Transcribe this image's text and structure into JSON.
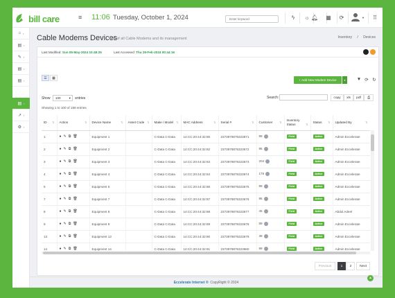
{
  "header": {
    "logo_text": "bill care",
    "time": "11:06",
    "date": "Tuesday, October 1, 2024",
    "search_placeholder": "Enter keyword",
    "icons": [
      "bolt-icon",
      "sun-icon",
      "bell-icon",
      "grid-icon",
      "sync-icon",
      "user-avatar-icon",
      "apps-icon"
    ]
  },
  "sidebar": {
    "items": [
      {
        "icon": "home-icon"
      },
      {
        "icon": "list-icon"
      },
      {
        "icon": "wrench-icon"
      },
      {
        "icon": "list-icon"
      },
      {
        "icon": "list-icon"
      },
      {
        "icon": "list-icon",
        "active": true
      },
      {
        "icon": "chart-icon"
      },
      {
        "icon": "settings-icon"
      }
    ]
  },
  "page": {
    "title": "Cable Modems Devices",
    "subtitle": "List of all Cable Modems and its management",
    "breadcrumb": [
      "Inventory",
      "Devices"
    ]
  },
  "meta": {
    "last_modified_label": "Last Modified:",
    "last_modified_value": "Sun 05-May-2024 10:48:25",
    "last_accessed_label": "Last Accessed:",
    "last_accessed_value": "Thu 29-Feb-2024 00:44:16"
  },
  "toolbar": {
    "add_button": "+ Add New Modem Device",
    "show_label": "Show",
    "show_value": "100",
    "entries_label": "entries",
    "search_label": "Search:",
    "export_buttons": [
      "copy",
      "xls",
      "pdf"
    ],
    "showing_text": "Showing 1 to 100 of 159 entries"
  },
  "table": {
    "columns": [
      "ID",
      "Action",
      "Device Name",
      "Asset Code",
      "Make / Model",
      "MAC Address",
      "Serial #",
      "Customer",
      "Inventory Status",
      "Status",
      "Updated By"
    ],
    "rows": [
      {
        "id": "1",
        "name": "Equipment 1",
        "asset": "",
        "model": "C-Data C-Data",
        "mac": "14:CC:20:44:32:85",
        "serial": "2373978876323671",
        "customer": "89",
        "inv": "Field",
        "status": "Active",
        "updated": "Admin Eccelerate"
      },
      {
        "id": "2",
        "name": "Equipment 2",
        "asset": "",
        "model": "C-Data C-Data",
        "mac": "14:CC:20:44:32:82",
        "serial": "2373978876323672",
        "customer": "85",
        "inv": "Field",
        "status": "Active",
        "updated": "Admin Eccelerate"
      },
      {
        "id": "3",
        "name": "Equipment 3",
        "asset": "",
        "model": "C-Data C-Data",
        "mac": "14:CC:20:44:32:83",
        "serial": "2373978876323673",
        "customer": "204",
        "inv": "Field",
        "status": "Active",
        "updated": "Admin Eccelerate"
      },
      {
        "id": "4",
        "name": "Equipment 4",
        "asset": "",
        "model": "C-Data C-Data",
        "mac": "14:CC:20:44:32:84",
        "serial": "2373978876323674",
        "customer": "176",
        "inv": "Field",
        "status": "Active",
        "updated": "Admin Eccelerate"
      },
      {
        "id": "5",
        "name": "Equipment 5",
        "asset": "",
        "model": "C-Data C-Data",
        "mac": "14:CC:20:44:32:86",
        "serial": "2373978876323675",
        "customer": "89",
        "inv": "Field",
        "status": "Active",
        "updated": "Admin Eccelerate"
      },
      {
        "id": "7",
        "name": "Equipment 7",
        "asset": "",
        "model": "C-Data C-Data",
        "mac": "14:CC:20:44:32:87",
        "serial": "2373978876323676",
        "customer": "85",
        "inv": "Field",
        "status": "Active",
        "updated": "Admin Eccelerate"
      },
      {
        "id": "8",
        "name": "Equipment 8",
        "asset": "",
        "model": "C-Data C-Data",
        "mac": "14:CC:20:44:32:88",
        "serial": "2373978876323677",
        "customer": "45",
        "inv": "Field",
        "status": "Active",
        "updated": "Abdul Adeel"
      },
      {
        "id": "9",
        "name": "Equipment 9",
        "asset": "",
        "model": "C-Data C-Data",
        "mac": "14:CC:20:44:32:89",
        "serial": "2373978876323678",
        "customer": "89",
        "inv": "Field",
        "status": "Active",
        "updated": "Admin Eccelerate"
      },
      {
        "id": "13",
        "name": "Equipment 13",
        "asset": "",
        "model": "C-Data C-Data",
        "mac": "14:CC:20:44:32:90",
        "serial": "2373978876323679",
        "customer": "38",
        "inv": "Field",
        "status": "Active",
        "updated": "Admin Eccelerate"
      },
      {
        "id": "14",
        "name": "Equipment 14",
        "asset": "",
        "model": "C-Data C-Data",
        "mac": "14:CC:20:44:32:91",
        "serial": "2373978876323680",
        "customer": "89",
        "inv": "Field",
        "status": "Active",
        "updated": "Admin Eccelerate"
      }
    ]
  },
  "pagination": {
    "prev": "Previous",
    "pages": [
      "1",
      "2"
    ],
    "next": "Next",
    "current": "1"
  },
  "footer": {
    "brand": "Eccelerate Internet ®",
    "copyright": "CopyRight © 2024"
  },
  "colors": {
    "brand": "#5bb53e",
    "accent_text": "#2c9a4f"
  }
}
